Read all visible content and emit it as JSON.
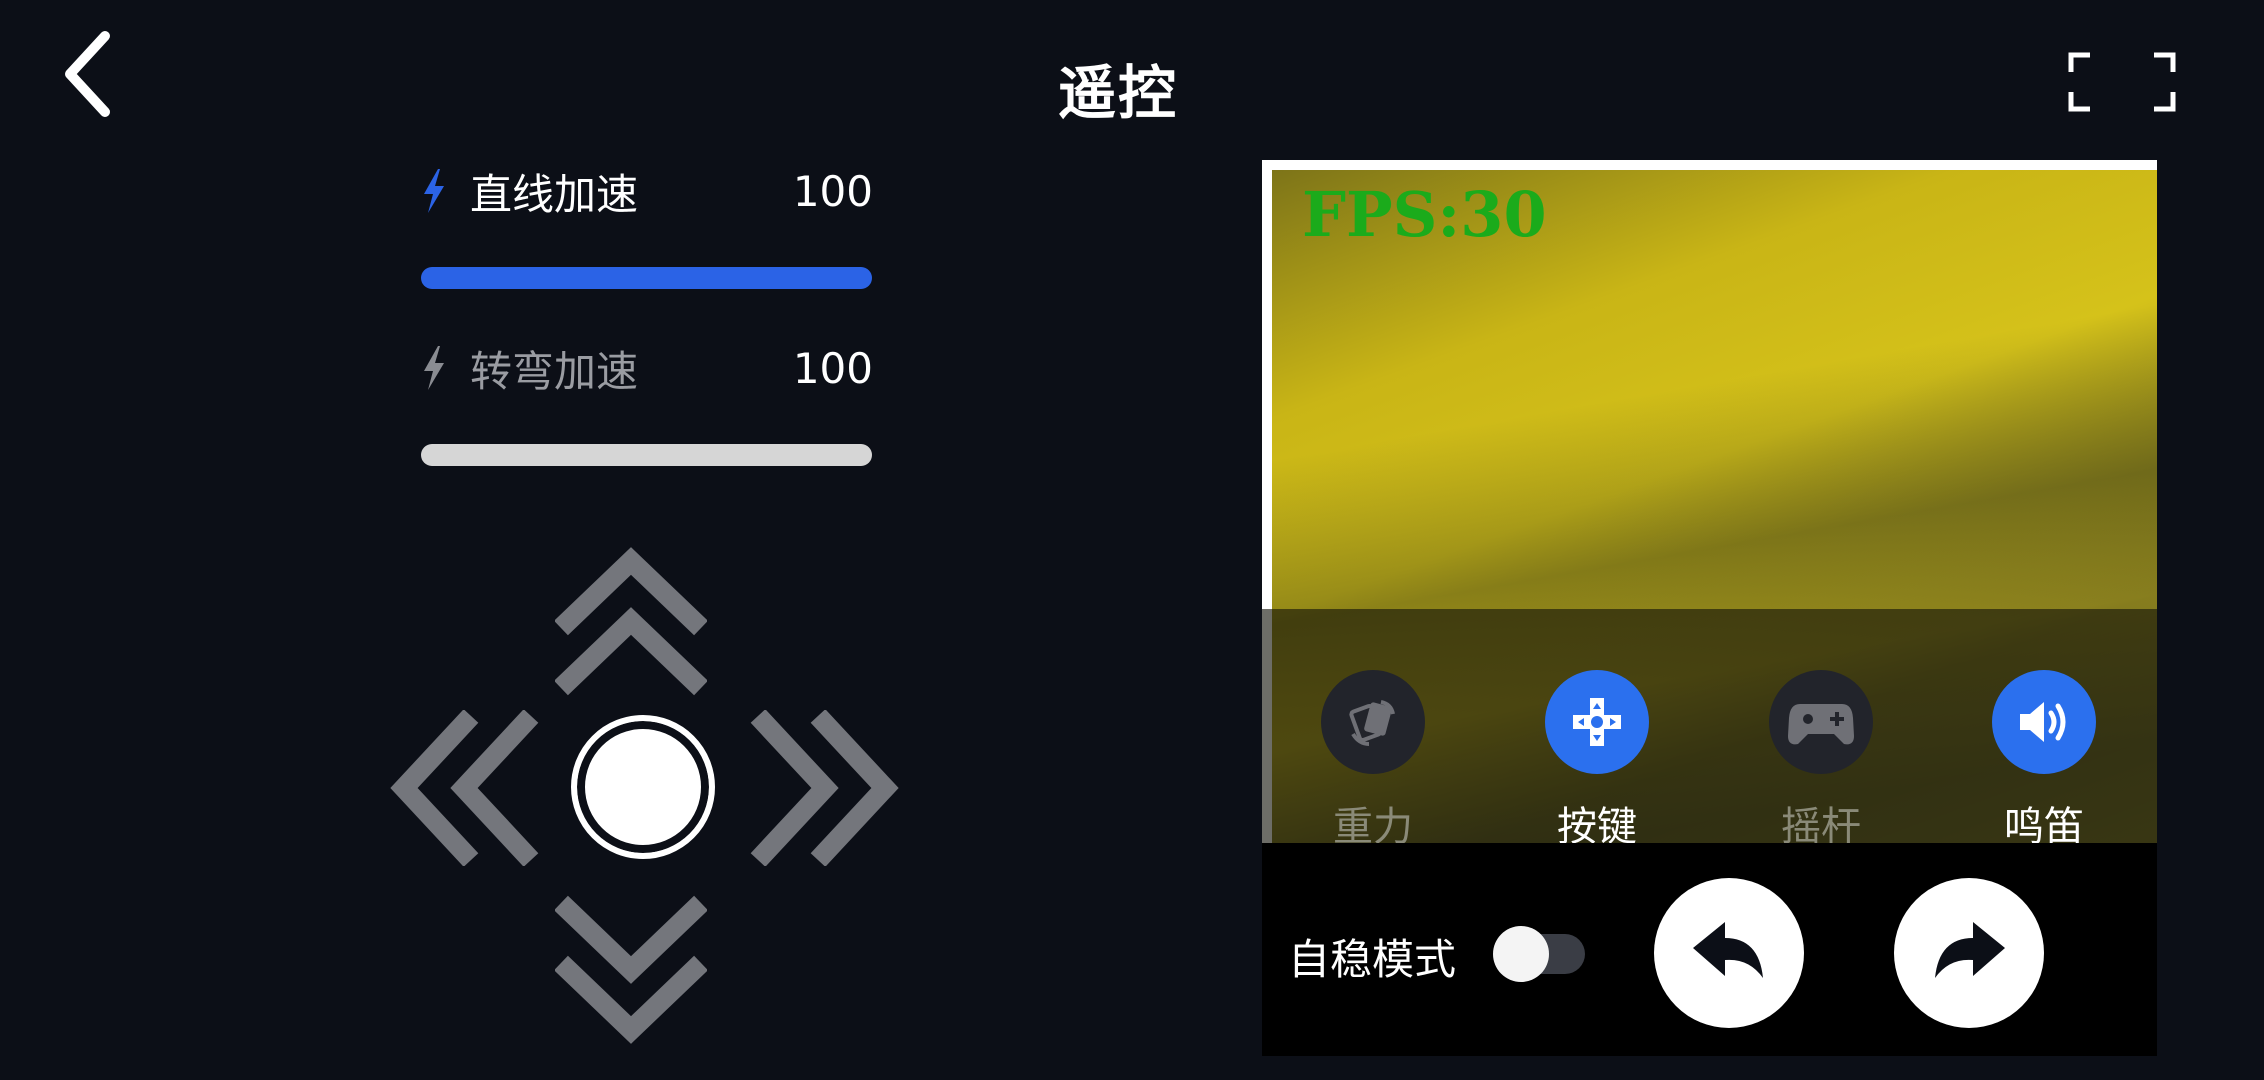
{
  "header": {
    "title": "遥控",
    "back_icon": "chevron-left-icon",
    "fullscreen_icon": "fullscreen-corners-icon"
  },
  "speed": {
    "linear": {
      "label": "直线加速",
      "value": "100",
      "icon": "lightning-icon",
      "active": true,
      "fill": 1.0,
      "color": "#2b63e6"
    },
    "turn": {
      "label": "转弯加速",
      "value": "100",
      "icon": "lightning-icon",
      "active": false,
      "fill": 1.0,
      "color": "#d6d6d6"
    }
  },
  "dpad": {
    "up_icon": "double-chevron-up-icon",
    "down_icon": "double-chevron-down-icon",
    "left_icon": "double-chevron-left-icon",
    "right_icon": "double-chevron-right-icon",
    "center_icon": "circle-button-icon"
  },
  "camera": {
    "fps_text": "FPS:30"
  },
  "modes": [
    {
      "label": "重力",
      "icon": "gravity-tilt-icon",
      "active": false
    },
    {
      "label": "按键",
      "icon": "dpad-icon",
      "active": true
    },
    {
      "label": "摇杆",
      "icon": "gamepad-icon",
      "active": false
    },
    {
      "label": "鸣笛",
      "icon": "speaker-icon",
      "active": true
    }
  ],
  "controls": {
    "stabilize_label": "自稳模式",
    "stabilize_on": false,
    "undo_icon": "undo-arrow-icon",
    "redo_icon": "redo-arrow-icon"
  },
  "colors": {
    "background": "#0c0f17",
    "accent": "#2b63e6",
    "dpad_gray": "#74767c",
    "fps_green": "#1bab1b"
  }
}
